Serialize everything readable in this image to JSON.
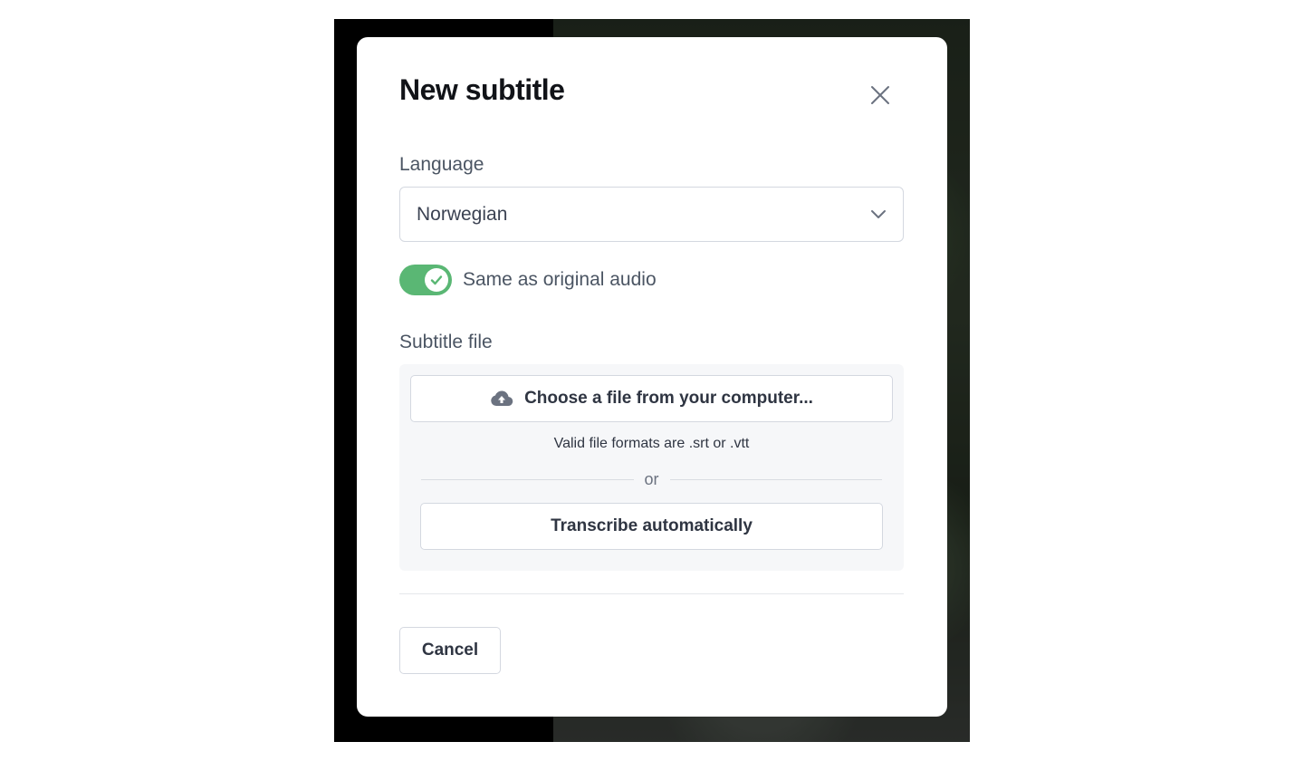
{
  "dialog": {
    "title": "New subtitle",
    "close_icon": "close-icon"
  },
  "language": {
    "label": "Language",
    "selected": "Norwegian",
    "chevron_icon": "chevron-down-icon"
  },
  "same_as_audio": {
    "label": "Same as original audio",
    "enabled": true,
    "accent_color": "#5ab774",
    "icon": "check-icon"
  },
  "subtitle_file": {
    "label": "Subtitle file",
    "choose_button": "Choose a file from your computer...",
    "upload_icon": "cloud-upload-icon",
    "hint": "Valid file formats are .srt or .vtt",
    "divider": "or",
    "transcribe_button": "Transcribe automatically"
  },
  "footer": {
    "cancel": "Cancel"
  }
}
